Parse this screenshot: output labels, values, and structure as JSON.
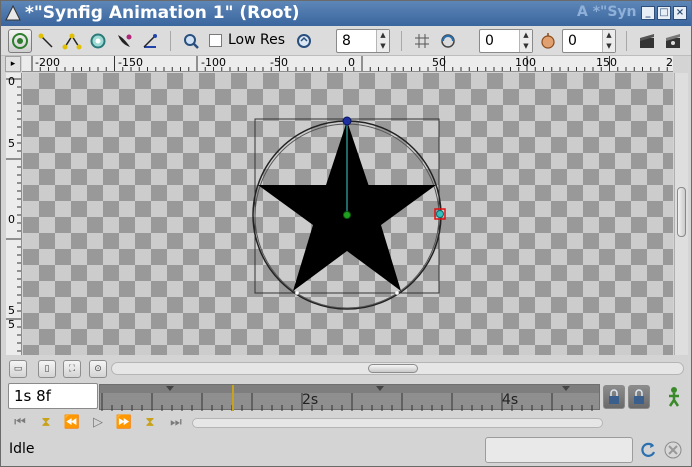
{
  "window": {
    "title": "*\"Synfig Animation 1\" (Root)",
    "ghost_title": "A *\"Syn",
    "controls": [
      "minimize-icon",
      "maximize-icon",
      "close-icon"
    ]
  },
  "toolbar": {
    "lowres_label": "Low Res",
    "lowres_checked": false,
    "quality_value": "8",
    "onion_past_value": "0",
    "onion_future_value": "0",
    "icons": [
      "transform-tool-icon",
      "smooth-move-icon",
      "scale-icon",
      "rotate-icon",
      "mirror-icon",
      "draw-icon",
      "zoom-icon",
      "refresh-icon",
      "grid-icon",
      "onion-skin-icon",
      "onion-past-icon",
      "render-icon",
      "preview-icon"
    ]
  },
  "rulers": {
    "horizontal_ticks": [
      "-200",
      "-150",
      "-100",
      "-50",
      "0",
      "50",
      "100",
      "150",
      "2"
    ],
    "vertical_ticks": [
      "0",
      "5",
      "0",
      "5",
      "5"
    ],
    "corner": "▸"
  },
  "time": {
    "current": "1s 8f",
    "labels": [
      "2s",
      "4s"
    ]
  },
  "status": {
    "text": "Idle"
  },
  "colors": {
    "titlebar": "#3a669e",
    "star": "#000000",
    "guide": "#2a8b8b",
    "time_cursor": "#c8a21a"
  }
}
